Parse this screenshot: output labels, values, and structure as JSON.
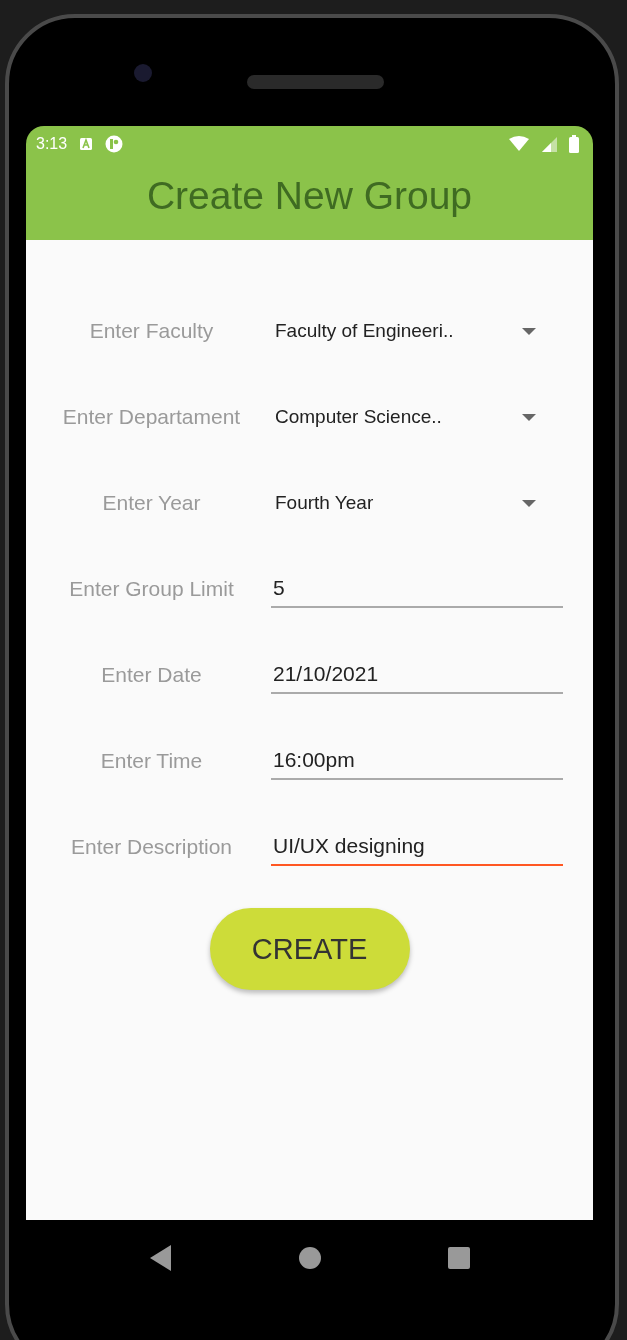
{
  "status_bar": {
    "time": "3:13"
  },
  "app_bar": {
    "title": "Create New Group"
  },
  "form": [
    {
      "kind": "dropdown",
      "label": "Enter Faculty",
      "value": "Faculty of Engineeri.."
    },
    {
      "kind": "dropdown",
      "label": "Enter Departament",
      "value": "Computer Science.."
    },
    {
      "kind": "dropdown",
      "label": "Enter Year",
      "value": "Fourth Year"
    },
    {
      "kind": "text",
      "label": "Enter Group Limit",
      "value": "5",
      "focused": false
    },
    {
      "kind": "text",
      "label": "Enter Date",
      "value": "21/10/2021",
      "focused": false
    },
    {
      "kind": "text",
      "label": "Enter Time",
      "value": "16:00pm",
      "focused": false
    },
    {
      "kind": "text",
      "label": "Enter Description",
      "value": "UI/UX designing",
      "focused": true
    }
  ],
  "button": {
    "label": "CREATE"
  }
}
